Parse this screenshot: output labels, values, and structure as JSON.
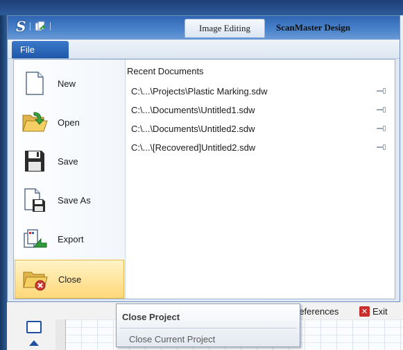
{
  "app": {
    "logo_text": "S",
    "tabs": [
      {
        "label": "Image Editing",
        "active": true
      },
      {
        "label": "ScanMaster Design",
        "active": false
      }
    ]
  },
  "ribbon": {
    "file_tab": "File"
  },
  "backstage": {
    "menu": [
      {
        "label": "New",
        "icon": "new-document-icon"
      },
      {
        "label": "Open",
        "icon": "open-folder-icon"
      },
      {
        "label": "Save",
        "icon": "floppy-disk-icon"
      },
      {
        "label": "Save As",
        "icon": "save-as-icon"
      },
      {
        "label": "Export",
        "icon": "export-icon"
      },
      {
        "label": "Close",
        "icon": "close-folder-icon",
        "selected": true
      }
    ],
    "recent_header": "Recent Documents",
    "recent": [
      "C:\\...\\Projects\\Plastic Marking.sdw",
      "C:\\...\\Documents\\Untitled1.sdw",
      "C:\\...\\Documents\\Untitled2.sdw",
      "C:\\...\\[Recovered]Untitled2.sdw"
    ],
    "preferences_label": "references",
    "exit_label": "Exit"
  },
  "tooltip": {
    "title": "Close Project",
    "description": "Close Current Project"
  },
  "colors": {
    "accent": "#1f58a9",
    "selected_bg": "#ffd87a",
    "exit_red": "#c9302c"
  }
}
